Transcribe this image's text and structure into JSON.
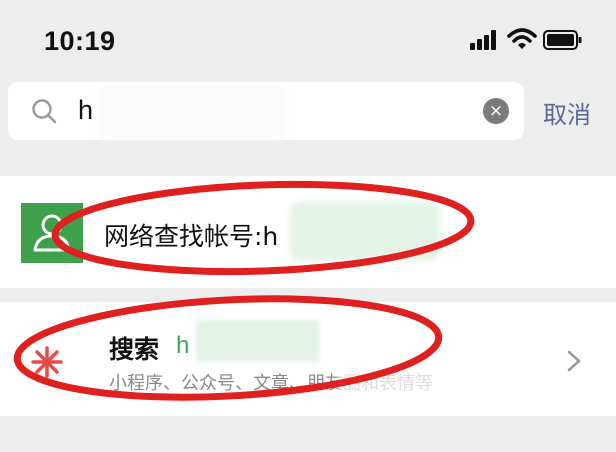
{
  "status_bar": {
    "time": "10:19",
    "icons": [
      "signal-icon",
      "wifi-icon",
      "battery-icon"
    ]
  },
  "search": {
    "query": "h",
    "clear_icon": "×",
    "cancel_label": "取消"
  },
  "find_account": {
    "label": "网络查找帐号:h"
  },
  "search_all": {
    "label": "搜索",
    "query": "h",
    "subtitle": "小程序、公众号、文章、朋友圈和表情等"
  },
  "colors": {
    "background": "#ededed",
    "accent_blue": "#576b95",
    "wechat_green": "#3ea04a",
    "annotation_red": "#e01f1f"
  }
}
